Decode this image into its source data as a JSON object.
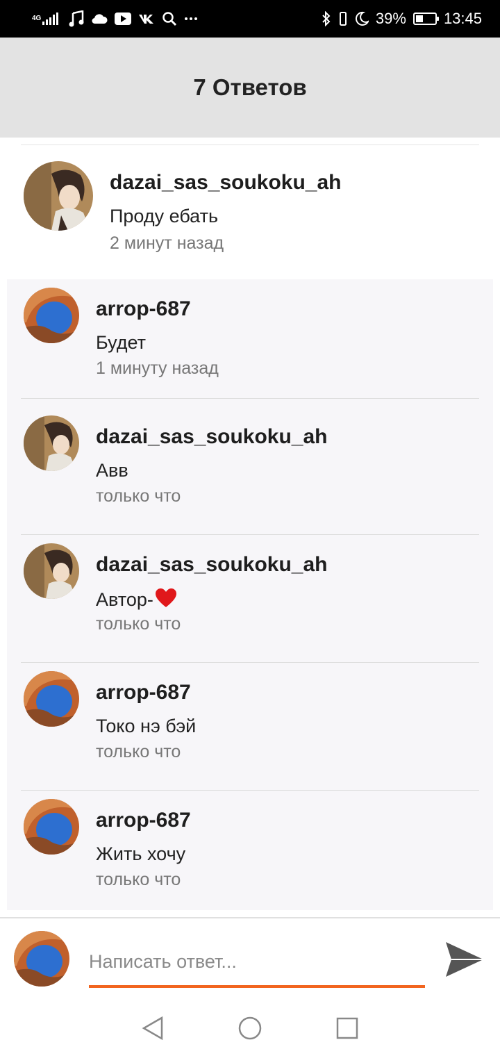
{
  "status_bar": {
    "network": "4G",
    "battery_percent": "39%",
    "battery_level": 0.39,
    "time": "13:45",
    "left_icons": [
      "signal-icon",
      "music-icon",
      "cloud-icon",
      "youtube-icon",
      "vk-icon",
      "search-icon",
      "more-icon"
    ],
    "right_icons": [
      "bluetooth-icon",
      "vibrate-icon",
      "moon-icon",
      "battery-icon"
    ]
  },
  "header": {
    "title": "7 Ответов"
  },
  "parent_comment": {
    "username": "dazai_sas_soukoku_ah",
    "text": "Проду ебать",
    "time": "2 минут назад",
    "avatar": "anime-avatar"
  },
  "replies": [
    {
      "username": "arrop-687",
      "text": "Будет",
      "time": "1 минуту назад",
      "avatar": "arch-avatar"
    },
    {
      "username": "dazai_sas_soukoku_ah",
      "text": "Авв",
      "time": "только что",
      "avatar": "anime-avatar"
    },
    {
      "username": "dazai_sas_soukoku_ah",
      "text": "Автор-",
      "emoji": "❤️",
      "time": "только что",
      "avatar": "anime-avatar"
    },
    {
      "username": "arrop-687",
      "text": "Токо нэ бэй",
      "time": "только что",
      "avatar": "arch-avatar"
    },
    {
      "username": "arrop-687",
      "text": "Жить хочу",
      "time": "только что",
      "avatar": "arch-avatar"
    }
  ],
  "compose": {
    "placeholder": "Написать ответ...",
    "value": "",
    "accent_color": "#f2651f"
  },
  "nav": {
    "icons": [
      "back-icon",
      "home-icon",
      "recents-icon"
    ]
  },
  "colors": {
    "header_bg": "#e3e3e3",
    "replies_bg": "#f7f6f9",
    "heart": "#e0181b"
  }
}
